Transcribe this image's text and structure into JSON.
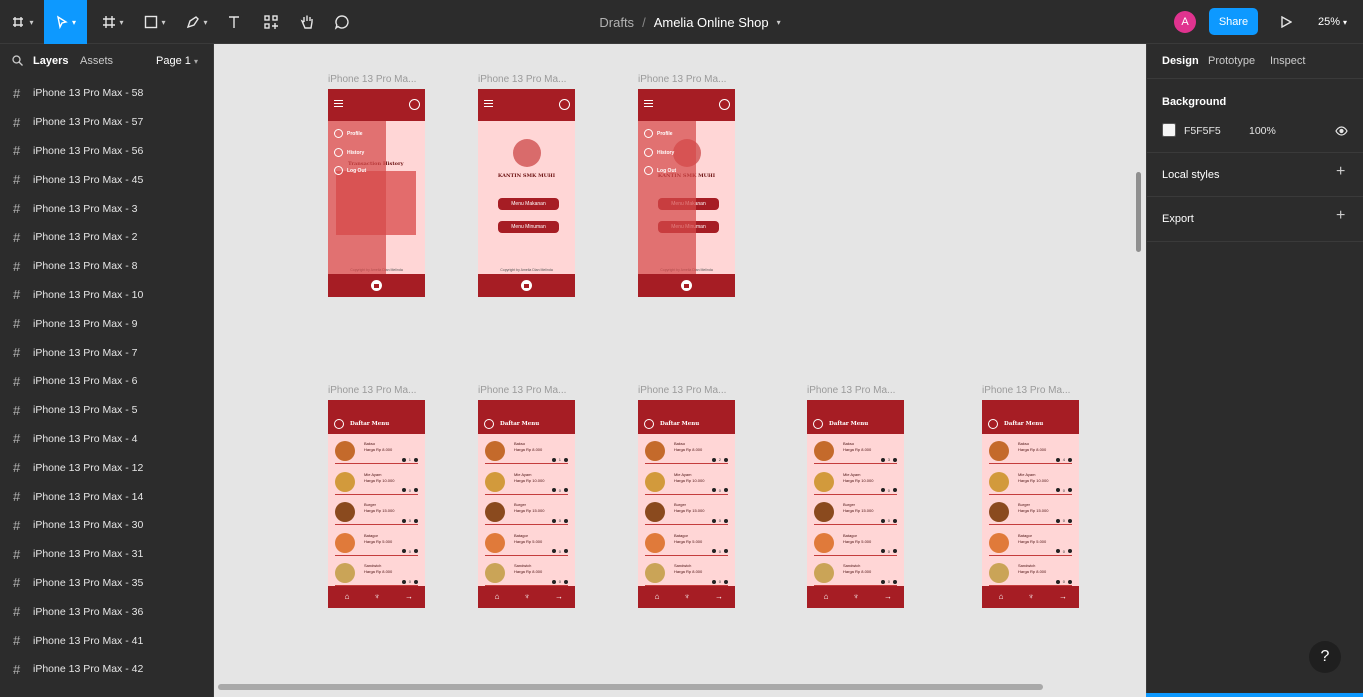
{
  "toolbar": {
    "title_drafts": "Drafts",
    "title_sep": "/",
    "file_name": "Amelia Online Shop",
    "avatar_letter": "A",
    "share_label": "Share",
    "zoom": "25%"
  },
  "left_panel": {
    "tabs": {
      "layers": "Layers",
      "assets": "Assets",
      "page": "Page 1"
    },
    "layers": [
      "iPhone 13 Pro Max - 58",
      "iPhone 13 Pro Max - 57",
      "iPhone 13 Pro Max - 56",
      "iPhone 13 Pro Max - 45",
      "iPhone 13 Pro Max - 3",
      "iPhone 13 Pro Max - 2",
      "iPhone 13 Pro Max - 8",
      "iPhone 13 Pro Max - 10",
      "iPhone 13 Pro Max - 9",
      "iPhone 13 Pro Max - 7",
      "iPhone 13 Pro Max - 6",
      "iPhone 13 Pro Max - 5",
      "iPhone 13 Pro Max - 4",
      "iPhone 13 Pro Max - 12",
      "iPhone 13 Pro Max - 14",
      "iPhone 13 Pro Max - 30",
      "iPhone 13 Pro Max - 31",
      "iPhone 13 Pro Max - 35",
      "iPhone 13 Pro Max - 36",
      "iPhone 13 Pro Max - 41",
      "iPhone 13 Pro Max - 42"
    ]
  },
  "canvas": {
    "frame_label": "iPhone 13 Pro Ma...",
    "home": {
      "shop_name": "KANTIN SMK MUHI",
      "btn_makanan": "Menu Makanan",
      "btn_minuman": "Menu Minuman",
      "copyright": "Copyright by Amelia Dian Melinda",
      "drawer_profile": "Profile",
      "drawer_history": "History",
      "drawer_logout": "Log Out",
      "transaction_history": "Transaction History"
    },
    "menu": {
      "title": "Daftar Menu",
      "items": [
        {
          "name": "Bakso",
          "price": "Harga Rp 8.000"
        },
        {
          "name": "Mie Ayam",
          "price": "Harga Rp 10.000"
        },
        {
          "name": "Burger",
          "price": "Harga Rp 15.000"
        },
        {
          "name": "Batagor",
          "price": "Harga Rp 5.000"
        },
        {
          "name": "Sandwich",
          "price": "Harga Rp 8.000"
        }
      ],
      "qty_frames": [
        [
          "1",
          "0",
          "0",
          "0",
          "0"
        ],
        [
          "1",
          "0",
          "0",
          "0",
          "0"
        ],
        [
          "2",
          "0",
          "0",
          "0",
          "0"
        ],
        [
          "3",
          "0",
          "0",
          "0",
          "0"
        ],
        [
          "4",
          "0",
          "0",
          "0",
          "0"
        ]
      ]
    }
  },
  "right_panel": {
    "tabs": {
      "design": "Design",
      "prototype": "Prototype",
      "inspect": "Inspect"
    },
    "background_label": "Background",
    "background_hex": "F5F5F5",
    "background_opacity": "100%",
    "local_styles": "Local styles",
    "export": "Export"
  },
  "colors": {
    "accent": "#0d99ff",
    "maroon": "#a61d24",
    "pink": "#ffd6d6"
  }
}
